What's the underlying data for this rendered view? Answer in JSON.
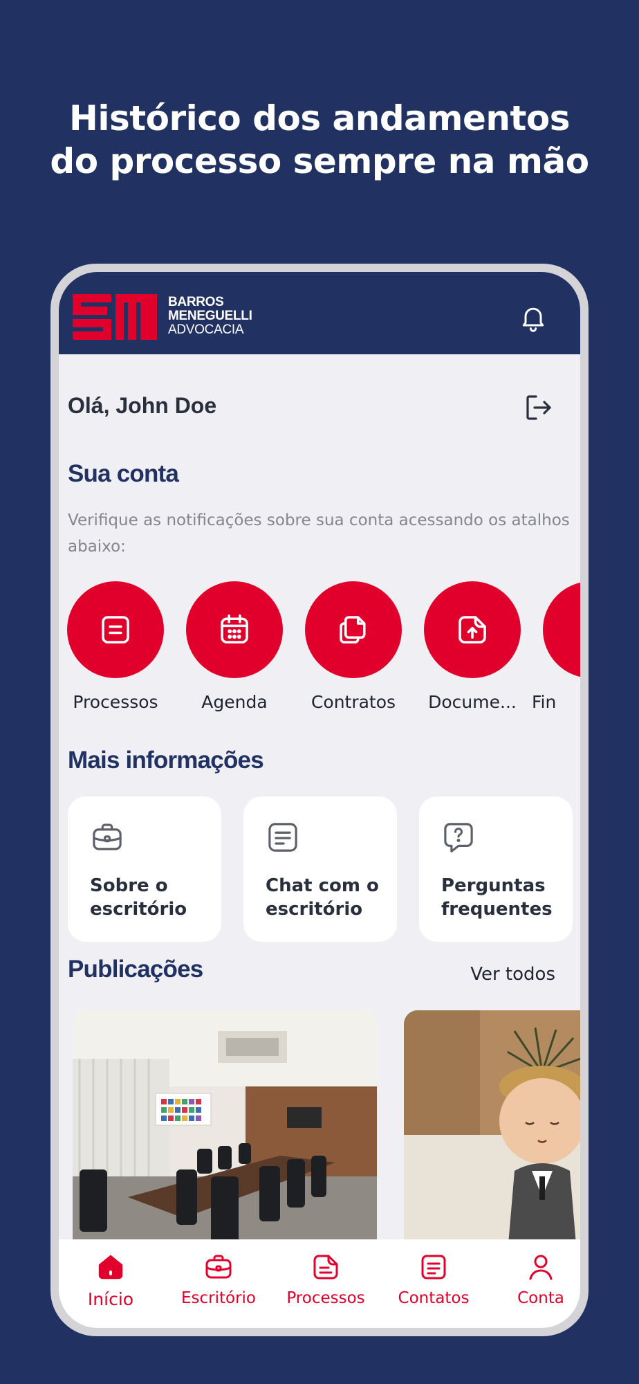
{
  "headline": {
    "line1": "Histórico dos andamentos",
    "line2": "do processo sempre na mão"
  },
  "header": {
    "logo_lines": [
      "BARROS",
      "MENEGUELLI",
      "ADVOCACIA"
    ],
    "bell_icon": "bell-icon"
  },
  "greeting": "Olá, John Doe",
  "account": {
    "title": "Sua conta",
    "subtitle": "Verifique as notificações sobre sua conta acessando os atalhos abaixo:",
    "shortcuts": [
      {
        "label": "Processos",
        "icon": "document-list-icon"
      },
      {
        "label": "Agenda",
        "icon": "calendar-icon"
      },
      {
        "label": "Contratos",
        "icon": "contracts-icon"
      },
      {
        "label": "Docume...",
        "icon": "document-upload-icon"
      },
      {
        "label": "Fin",
        "icon": "finance-icon"
      }
    ]
  },
  "more_info": {
    "title": "Mais informações",
    "cards": [
      {
        "label": "Sobre o escritório",
        "icon": "briefcase-icon"
      },
      {
        "label": "Chat com o escritório",
        "icon": "chat-icon"
      },
      {
        "label": "Perguntas frequentes",
        "icon": "question-chat-icon"
      }
    ]
  },
  "publications": {
    "title": "Publicações",
    "see_all": "Ver todos"
  },
  "tabbar": {
    "tabs": [
      {
        "label": "Início",
        "icon": "home-icon",
        "active": true
      },
      {
        "label": "Escritório",
        "icon": "briefcase-icon"
      },
      {
        "label": "Processos",
        "icon": "document-icon"
      },
      {
        "label": "Contatos",
        "icon": "contacts-icon"
      },
      {
        "label": "Conta",
        "icon": "user-icon"
      }
    ]
  },
  "colors": {
    "background": "#213162",
    "accent": "#e0002b",
    "screen": "#efeff4"
  }
}
